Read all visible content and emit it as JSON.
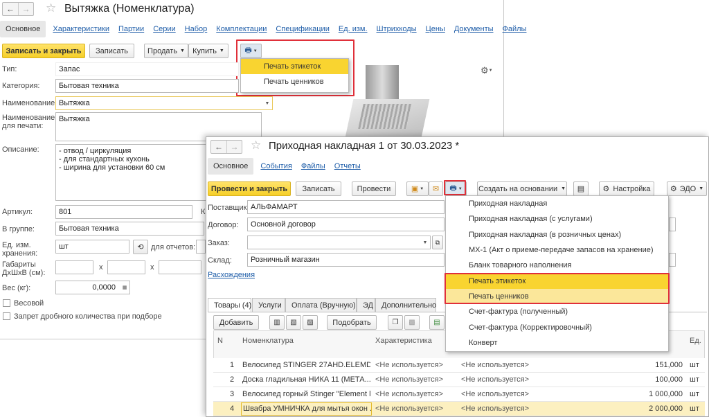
{
  "nomenclature": {
    "title": "Вытяжка (Номенклатура)",
    "tabs": [
      "Основное",
      "Характеристики",
      "Партии",
      "Серии",
      "Набор",
      "Комплектации",
      "Спецификации",
      "Ед. изм.",
      "Штрихкоды",
      "Цены",
      "Документы",
      "Файлы"
    ],
    "toolbar": {
      "save_close": "Записать и закрыть",
      "save": "Записать",
      "sell": "Продать",
      "buy": "Купить"
    },
    "print_menu": [
      "Печать этикеток",
      "Печать ценников"
    ],
    "fields": {
      "type_label": "Тип:",
      "type_value": "Запас",
      "category_label": "Категория:",
      "category_value": "Бытовая техника",
      "name_label": "Наименование:",
      "name_value": "Вытяжка",
      "print_name_label": "Наименование\nдля печати:",
      "print_name_value": "Вытяжка",
      "description_label": "Описание:",
      "description_value": "- отвод / циркуляция\n- для стандартных кухонь\n- ширина для установки 60 см",
      "article_label": "Артикул:",
      "article_value": "801",
      "code_label": "К",
      "group_label": "В группе:",
      "group_value": "Бытовая техника",
      "unit_label": "Ед. изм.\nхранения:",
      "unit_value": "шт",
      "reports_label": "для отчетов:",
      "dims_label": "Габариты\nДхШхВ (см):",
      "dims_x": "х",
      "weight_label": "Вес (кг):",
      "weight_value": "0,0000",
      "weighted_label": "Весовой",
      "fractional_label": "Запрет дробного количества при подборе"
    }
  },
  "invoice": {
    "title": "Приходная накладная 1 от 30.03.2023 *",
    "tabs": [
      "Основное",
      "События",
      "Файлы",
      "Отчеты"
    ],
    "toolbar": {
      "post_close": "Провести и закрыть",
      "save": "Записать",
      "post": "Провести",
      "create_based": "Создать на основании",
      "settings": "Настройка",
      "edo": "ЭДО"
    },
    "fields": {
      "supplier_label": "Поставщик:",
      "supplier_value": "АЛЬФАМАРТ",
      "contract_label": "Договор:",
      "contract_value": "Основной договор",
      "order_label": "Заказ:",
      "order_value": "",
      "warehouse_label": "Склад:",
      "warehouse_value": "Розничный магазин",
      "discrepancies": "Расхождения"
    },
    "grid_tabs": [
      "Товары (4)",
      "Услуги",
      "Оплата (Вручную)",
      "ЭД",
      "Дополнительно"
    ],
    "grid_buttons": {
      "add": "Добавить",
      "pick": "Подобрать"
    },
    "columns": {
      "n": "N",
      "item": "Номенклатура",
      "char": "Характеристика",
      "unit": "Ед."
    },
    "rows": [
      {
        "n": "1",
        "item": "Велосипед STINGER 27AHD.ELEMD...",
        "char": "<Не используется>",
        "batch": "<Не используется>",
        "qty": "151,000",
        "unit": "шт"
      },
      {
        "n": "2",
        "item": "Доска гладильная  НИКА 11 (МЕТА...",
        "char": "<Не используется>",
        "batch": "<Не используется>",
        "qty": "100,000",
        "unit": "шт"
      },
      {
        "n": "3",
        "item": "Велосипед горный Stinger \"Element l...",
        "char": "<Не используется>",
        "batch": "<Не используется>",
        "qty": "1 000,000",
        "unit": "шт"
      },
      {
        "n": "4",
        "item": "Швабра УМНИЧКА для мытья окон ...",
        "char": "<Не используется>",
        "batch": "<Не используется>",
        "qty": "2 000,000",
        "unit": "шт"
      }
    ],
    "print_menu": [
      "Приходная накладная",
      "Приходная накладная (с услугами)",
      "Приходная накладная (в розничных ценах)",
      "МХ-1 (Акт о приеме-передаче запасов на хранение)",
      "Бланк товарного наполнения",
      "Печать этикеток",
      "Печать ценников",
      "Счет-фактура (полученный)",
      "Счет-фактура (Корректировочный)",
      "Конверт"
    ]
  },
  "colors": {
    "accent_yellow": "#f6cf28",
    "highlight": "#f9d430",
    "link": "#1d5ca8",
    "red_box": "#e0303a"
  }
}
